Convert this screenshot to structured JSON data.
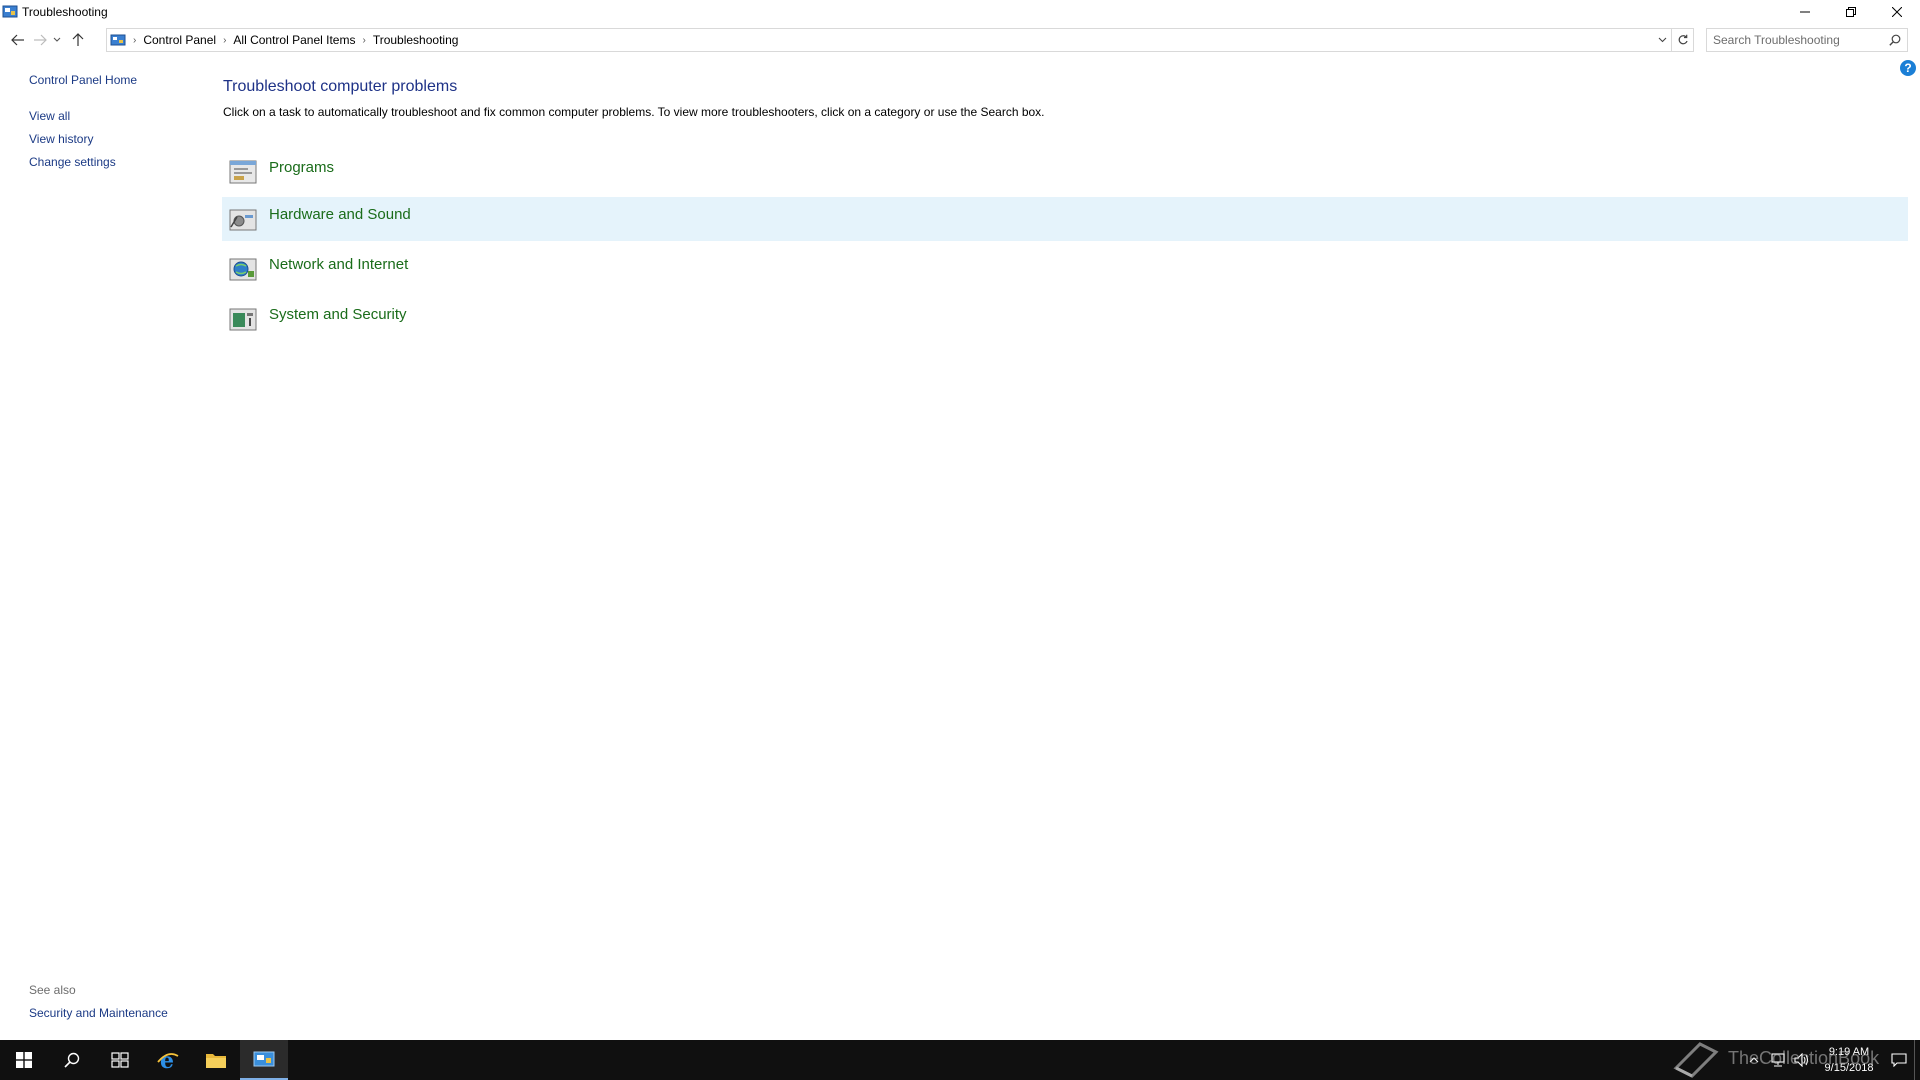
{
  "window": {
    "title": "Troubleshooting"
  },
  "address": {
    "crumbs": [
      "Control Panel",
      "All Control Panel Items",
      "Troubleshooting"
    ],
    "search_placeholder": "Search Troubleshooting"
  },
  "sidebar": {
    "home": "Control Panel Home",
    "links": [
      "View all",
      "View history",
      "Change settings"
    ],
    "see_also_heading": "See also",
    "see_also_links": [
      "Security and Maintenance"
    ]
  },
  "main": {
    "title": "Troubleshoot computer problems",
    "description": "Click on a task to automatically troubleshoot and fix common computer problems. To view more troubleshooters, click on a category or use the Search box.",
    "categories": [
      {
        "label": "Programs",
        "icon": "programs-icon"
      },
      {
        "label": "Hardware and Sound",
        "icon": "hardware-sound-icon"
      },
      {
        "label": "Network and Internet",
        "icon": "network-internet-icon"
      },
      {
        "label": "System and Security",
        "icon": "system-security-icon"
      }
    ]
  },
  "taskbar": {
    "time": "9:19 AM",
    "date": "9/15/2018",
    "watermark": "TheCollectionBook"
  },
  "colors": {
    "link": "#1b3a85",
    "category_link": "#1a6c1a",
    "hover_row": "#e5f3fb",
    "taskbar": "#101010"
  }
}
